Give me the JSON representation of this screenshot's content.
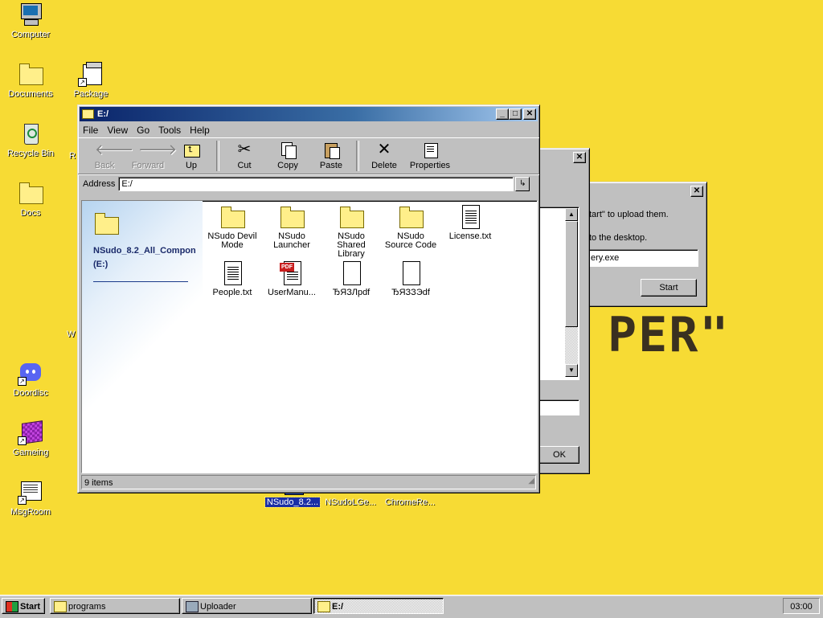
{
  "desktop": {
    "icons": [
      {
        "label": "Computer"
      },
      {
        "label": "Documents"
      },
      {
        "label": "Package"
      },
      {
        "label": "Recycle Bin"
      },
      {
        "label": "Docs"
      },
      {
        "label": "Doordisc"
      },
      {
        "label": "Gameing"
      },
      {
        "label": "MsgRoom"
      },
      {
        "label": "NSudo_8.2..."
      },
      {
        "label": "NSudoLGe..."
      },
      {
        "label": "ChromeRe..."
      }
    ],
    "clipped_letters": {
      "r": "R",
      "w": "W"
    },
    "wallpaper_text": "PER\""
  },
  "uploader": {
    "instruction": "tart\" to upload them.",
    "hint": "to the desktop.",
    "file_value": "ery.exe",
    "start_label": "Start",
    "close_glyph": "✕"
  },
  "programs_dialog": {
    "ok_label": "OK",
    "close_glyph": "✕"
  },
  "explorer": {
    "title": "E:/",
    "menu": [
      "File",
      "View",
      "Go",
      "Tools",
      "Help"
    ],
    "toolbar": {
      "back": "Back",
      "forward": "Forward",
      "up": "Up",
      "cut": "Cut",
      "copy": "Copy",
      "paste": "Paste",
      "delete": "Delete",
      "properties": "Properties"
    },
    "address_label": "Address",
    "address_value": "E:/",
    "drive_name": "NSudo_8.2_All_Compon",
    "drive_letter": "(E:)",
    "files": [
      {
        "name": "NSudo Devil Mode"
      },
      {
        "name": "NSudo Launcher"
      },
      {
        "name": "NSudo Shared Library"
      },
      {
        "name": "NSudo Source Code"
      },
      {
        "name": "License.txt"
      },
      {
        "name": "People.txt"
      },
      {
        "name": "UserManu..."
      },
      {
        "name": "ЂЯЗЛpdf"
      },
      {
        "name": "ЂЯЗЗЭdf"
      }
    ],
    "status": "9 items"
  },
  "taskbar": {
    "start": "Start",
    "tasks": [
      {
        "label": "programs"
      },
      {
        "label": "Uploader"
      },
      {
        "label": "E:/"
      }
    ],
    "clock": "03:00"
  },
  "colors": {
    "desktop": "#f7db34",
    "title_active": "#0a246a",
    "selection": "#1a2ea6"
  }
}
